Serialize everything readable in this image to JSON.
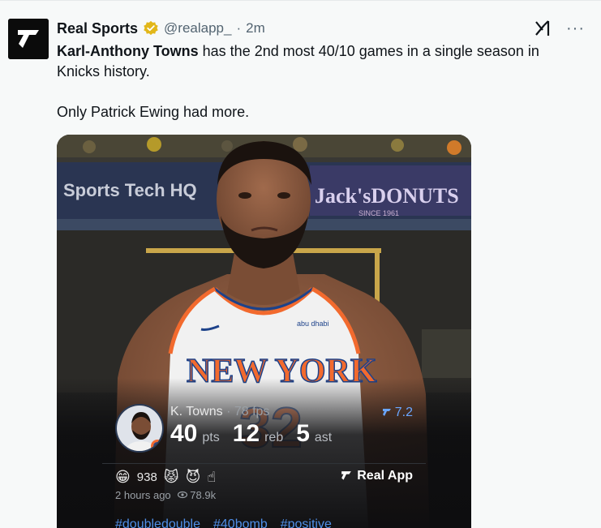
{
  "account": {
    "display_name": "Real Sports",
    "handle": "@realapp_",
    "dot": "·",
    "time": "2m",
    "avatar_icon": "real-sports-logo-icon",
    "verified_icon": "verified-badge-icon"
  },
  "top_actions": {
    "grok_icon": "grok-icon",
    "more_label": "···"
  },
  "post": {
    "bold_name": "Karl-Anthony Towns",
    "line1_rest": " has the 2nd most 40/10 games in a single season in Knicks history.",
    "line2": "Only Patrick Ewing had more."
  },
  "media": {
    "banner_left": "Sports Tech HQ",
    "banner_right": "Jack'sDONUTS",
    "banner_right_sub": "SINCE 1961",
    "jersey_text": "NEW YORK",
    "jersey_number": "32",
    "jersey_sponsor": "abu dhabi",
    "card": {
      "player_name": "K. Towns",
      "sep": " · ",
      "fps": "78 fps",
      "rating": "7.2",
      "stats": [
        {
          "num": "40",
          "unit": "pts"
        },
        {
          "num": "12",
          "unit": "reb"
        },
        {
          "num": "5",
          "unit": "ast"
        }
      ],
      "reaction_count": "938",
      "real_app_label": "Real App",
      "time_ago": "2 hours ago",
      "views": "78.9k",
      "hashtags": [
        "#doubledouble",
        "#40bomb",
        "#positive"
      ]
    }
  },
  "colors": {
    "accent": "#4f8fe8",
    "verified": "#e2b719",
    "knicks_orange": "#f26a2e",
    "knicks_blue": "#1d428a"
  }
}
